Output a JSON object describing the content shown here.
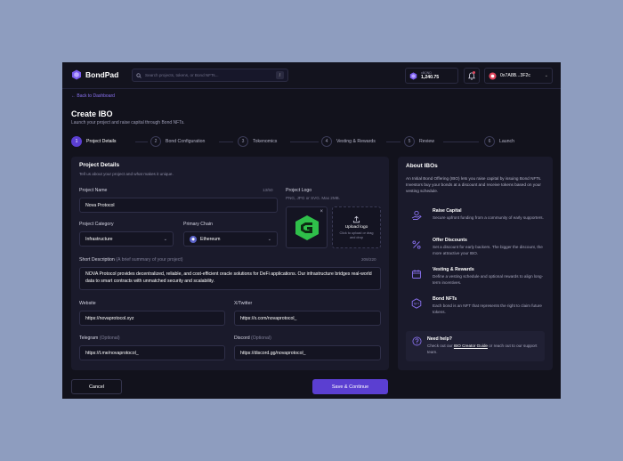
{
  "app": {
    "name": "BondPad"
  },
  "search": {
    "placeholder": "Search projects, tokens, or Bond NFTs...",
    "shortcut": "/"
  },
  "balance": {
    "label": "xBOND",
    "value": "1,240.75"
  },
  "wallet": {
    "address": "0x7A8B...3F2c"
  },
  "nav": {
    "back_label": "Back to Dashboard"
  },
  "page": {
    "title": "Create IBO",
    "subtitle": "Launch your project and raise capital through Bond NFTs."
  },
  "steps": [
    {
      "num": "1",
      "label": "Project Details",
      "active": true
    },
    {
      "num": "2",
      "label": "Bond Configuration"
    },
    {
      "num": "3",
      "label": "Tokenomics"
    },
    {
      "num": "4",
      "label": "Vesting & Rewards"
    },
    {
      "num": "5",
      "label": "Review"
    },
    {
      "num": "6",
      "label": "Launch"
    }
  ],
  "form": {
    "title": "Project Details",
    "subtitle": "Tell us about your project and what makes it unique.",
    "name": {
      "label": "Project Name",
      "counter": "13/50",
      "value": "Nova Protocol"
    },
    "category": {
      "label": "Project Category",
      "value": "Infrastructure"
    },
    "chain": {
      "label": "Primary Chain",
      "value": "Ethereum"
    },
    "logo": {
      "label": "Project Logo",
      "hint": "PNG, JPG or SVG. Max 2MB.",
      "upload_label": "Upload logo",
      "upload_hint": "Click to upload or drag and drop"
    },
    "description": {
      "label": "Short Description",
      "hint": "(A brief summary of your project)",
      "counter": "208/220",
      "value": "NOVA Protocol provides decentralized, reliable, and cost-efficient oracle solutions for DeFi applications. Our infrastructure bridges real-world data to smart contracts with unmatched security and scalability."
    },
    "website": {
      "label": "Website",
      "value": "https://novaprotocol.xyz"
    },
    "twitter": {
      "label": "X/Twitter",
      "value": "https://x.com/novaprotocol_"
    },
    "telegram": {
      "label": "Telegram",
      "optional": "(Optional)",
      "value": "https://t.me/novaprotocol_"
    },
    "discord": {
      "label": "Discord",
      "optional": "(Optional)",
      "value": "https://discord.gg/novaprotocol_"
    }
  },
  "actions": {
    "cancel": "Cancel",
    "save": "Save & Continue"
  },
  "about": {
    "title": "About IBOs",
    "description": "An Initial Bond Offering (IBO) lets you raise capital by issuing Bond NFTs. Investors buy your bonds at a discount and receive tokens based on your vesting schedule.",
    "features": [
      {
        "icon": "hand-coin-icon",
        "title": "Raise Capital",
        "desc": "Secure upfront funding from a community of early supporters."
      },
      {
        "icon": "percent-icon",
        "title": "Offer Discounts",
        "desc": "Set a discount for early backers. The bigger the discount, the more attractive your IBO."
      },
      {
        "icon": "calendar-icon",
        "title": "Vesting & Rewards",
        "desc": "Define a vesting schedule and optional rewards to align long-term incentives."
      },
      {
        "icon": "nft-icon",
        "title": "Bond NFTs",
        "desc": "Each bond is an NFT that represents the right to claim future tokens."
      }
    ],
    "help": {
      "title": "Need help?",
      "text_before": "Check out our ",
      "link": "IBO Creator Guide",
      "text_after": " or reach out to our support team."
    }
  },
  "colors": {
    "accent": "#5b3fd1",
    "link": "#8a72f0",
    "background": "#12121c",
    "card": "#1a1a2b"
  }
}
